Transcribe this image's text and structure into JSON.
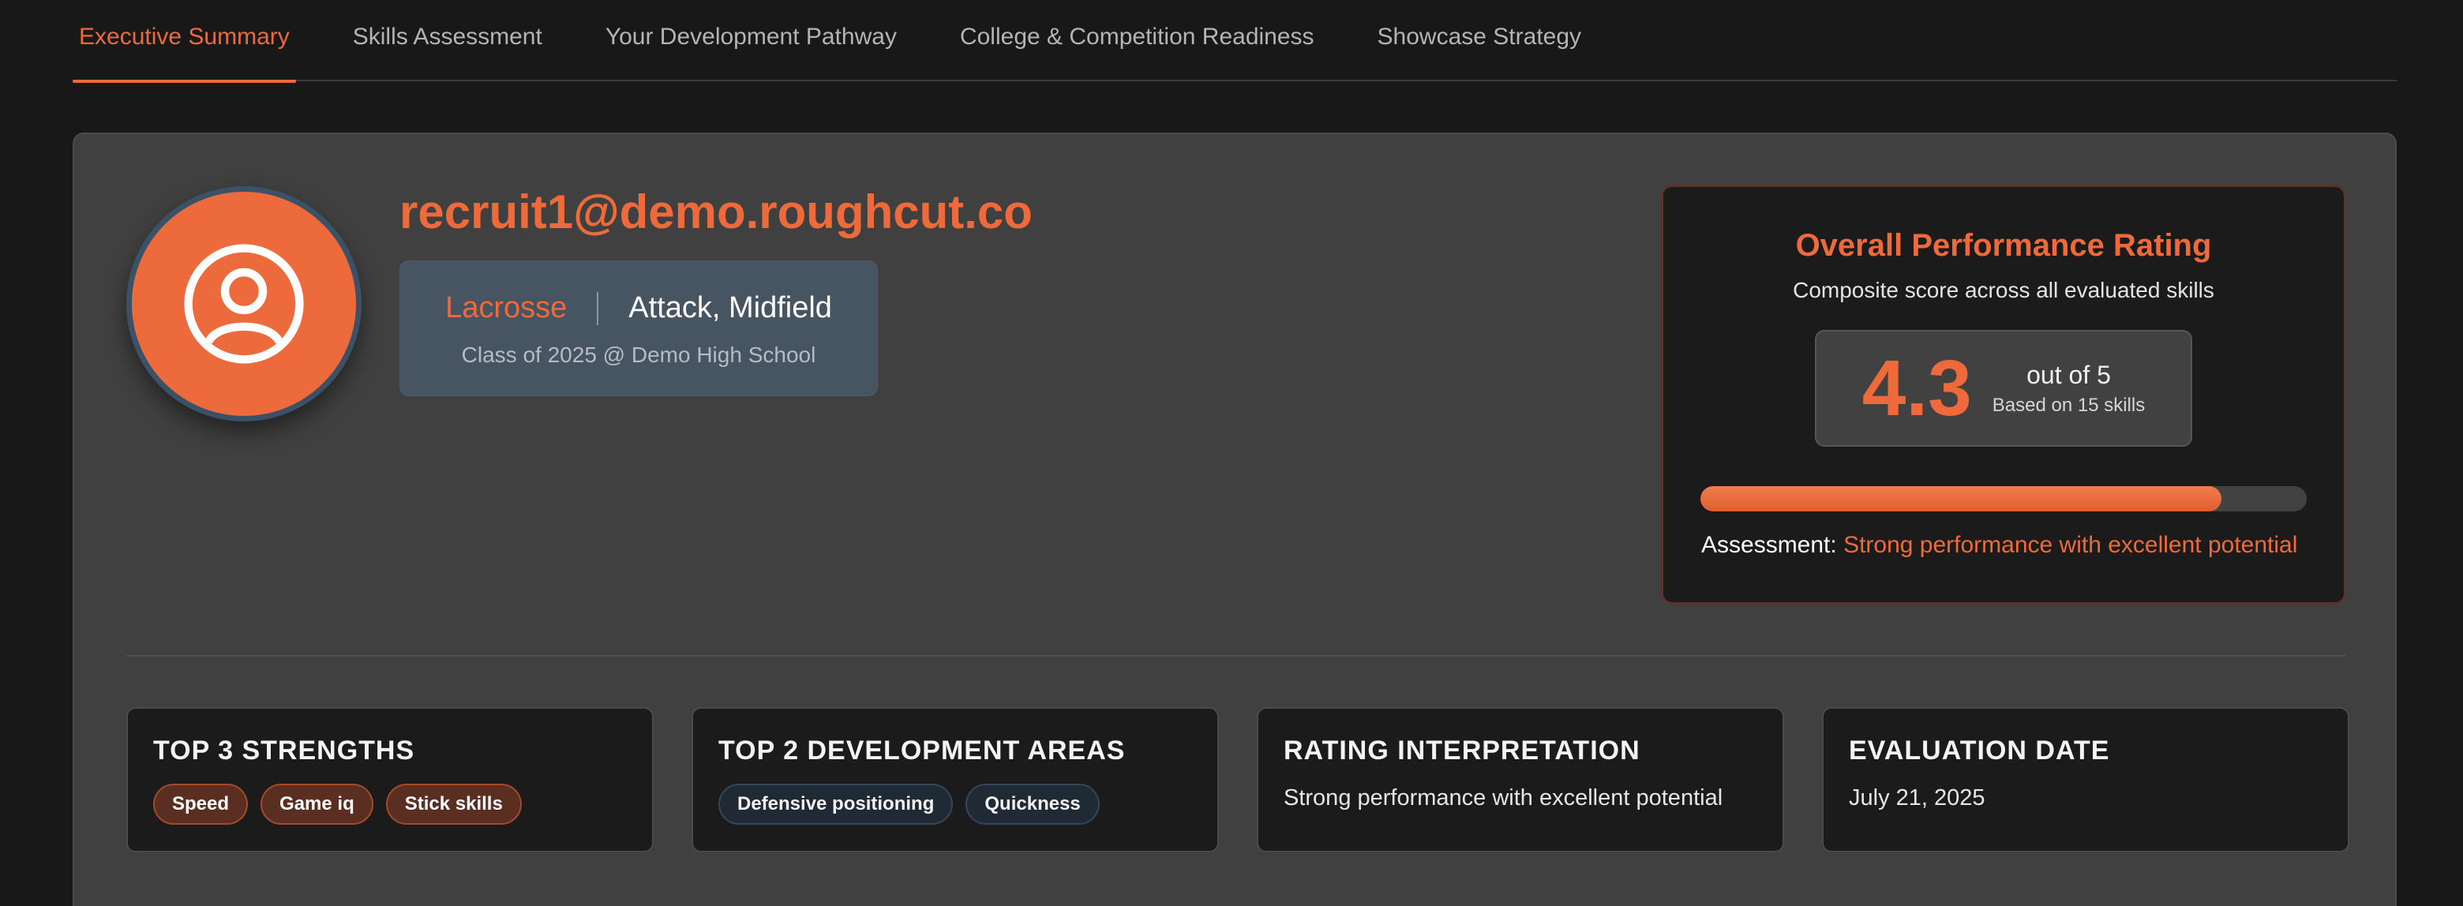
{
  "tabs": [
    {
      "label": "Executive Summary",
      "active": true
    },
    {
      "label": "Skills Assessment",
      "active": false
    },
    {
      "label": "Your Development Pathway",
      "active": false
    },
    {
      "label": "College & Competition Readiness",
      "active": false
    },
    {
      "label": "Showcase Strategy",
      "active": false
    }
  ],
  "profile": {
    "email": "recruit1@demo.roughcut.co",
    "sport": "Lacrosse",
    "positions": "Attack, Midfield",
    "class_line": "Class of 2025 @ Demo High School",
    "avatar_icon": "user-circle-icon"
  },
  "rating": {
    "title": "Overall Performance Rating",
    "subtitle": "Composite score across all evaluated skills",
    "score": "4.3",
    "out_of": "out of 5",
    "based_on": "Based on 15 skills",
    "fraction": 0.86,
    "assessment_label": "Assessment:",
    "assessment_value": "Strong performance with excellent potential"
  },
  "strengths": {
    "title": "TOP 3 STRENGTHS",
    "items": [
      "Speed",
      "Game iq",
      "Stick skills"
    ]
  },
  "development": {
    "title": "TOP 2 DEVELOPMENT AREAS",
    "items": [
      "Defensive positioning",
      "Quickness"
    ]
  },
  "interpretation": {
    "title": "RATING INTERPRETATION",
    "text": "Strong performance with excellent potential"
  },
  "evaluation": {
    "title": "EVALUATION DATE",
    "text": "July 21, 2025"
  },
  "colors": {
    "accent": "#ee6a3a",
    "background": "#181818",
    "card": "#404040",
    "panel": "#1b1b1b"
  }
}
